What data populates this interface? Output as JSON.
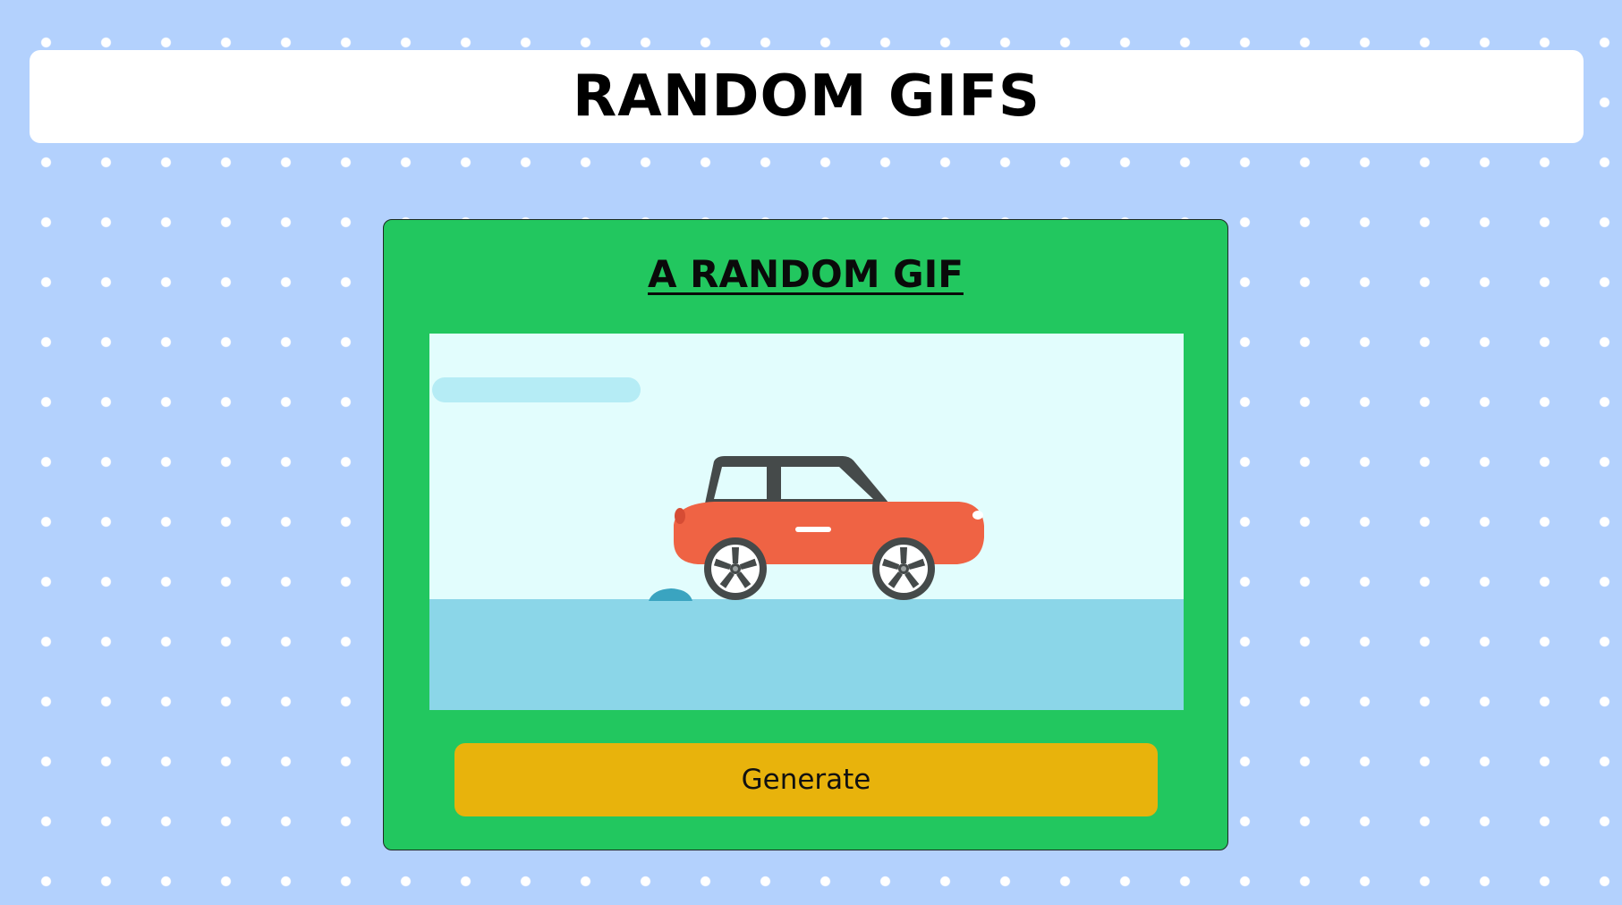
{
  "header": {
    "title": "RANDOM GIFS"
  },
  "card": {
    "title": "A RANDOM GIF",
    "gif_subject": "red-car-animation",
    "generate_label": "Generate"
  },
  "colors": {
    "page_background": "#b3d1fd",
    "card_background": "#22c75f",
    "button_background": "#e8b30c",
    "car_body": "#ef6344",
    "ground": "#8bd6e8",
    "sky": "#e2fdfd"
  }
}
